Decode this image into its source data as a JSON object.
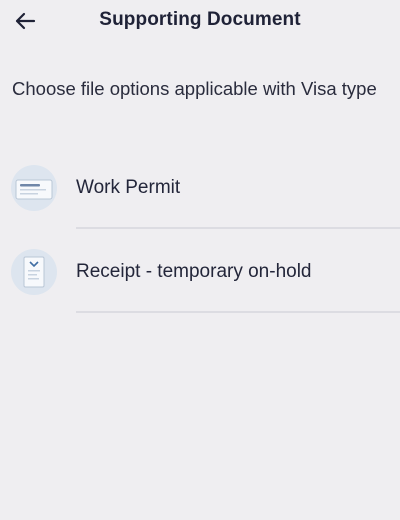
{
  "header": {
    "back_icon": "arrow-left-icon",
    "title": "Supporting Document"
  },
  "intro_text": "Choose file options applicable with Visa type",
  "options": [
    {
      "label": "Work Permit",
      "icon": "work-permit-card-icon"
    },
    {
      "label": "Receipt - temporary on-hold",
      "icon": "receipt-document-icon"
    }
  ],
  "colors": {
    "background": "#efeef1",
    "text": "#1f2237",
    "icon_circle": "#dde5ef",
    "divider": "#dcdce2"
  }
}
